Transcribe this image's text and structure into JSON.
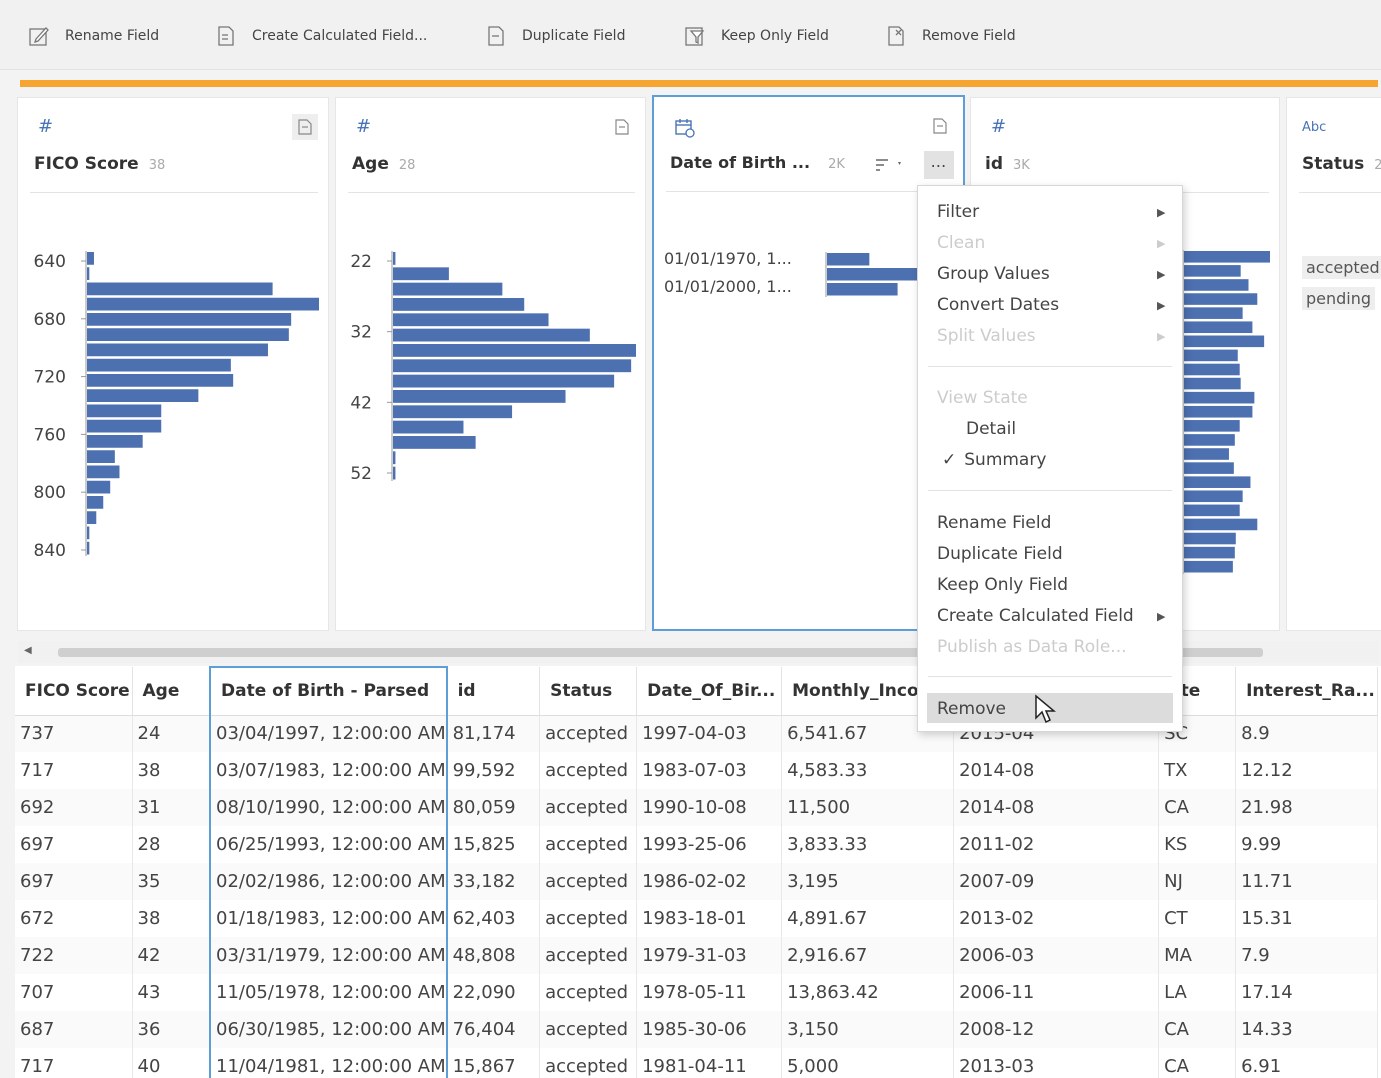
{
  "toolbar": {
    "rename": "Rename Field",
    "calc": "Create Calculated Field...",
    "duplicate": "Duplicate Field",
    "keep_only": "Keep Only Field",
    "remove": "Remove Field"
  },
  "colors": {
    "accent": "#f5a530",
    "bar": "#4d70b0",
    "selection": "#5d9ed6"
  },
  "cards": [
    {
      "title": "FICO Score",
      "count": "38",
      "type_icon": "#",
      "ticks": [
        "640",
        "680",
        "720",
        "760",
        "800",
        "840"
      ]
    },
    {
      "title": "Age",
      "count": "28",
      "type_icon": "#",
      "ticks": [
        "22",
        "32",
        "42",
        "52"
      ]
    },
    {
      "title": "Date of Birth ...",
      "count": "2K",
      "type_icon": "calendar",
      "values": [
        "01/01/1970, 1...",
        "01/01/2000, 1..."
      ]
    },
    {
      "title": "id",
      "count": "3K",
      "type_icon": "#"
    },
    {
      "title": "Status",
      "count": "2",
      "type_icon": "Abc",
      "values": [
        "accepted",
        "pending"
      ]
    }
  ],
  "chart_data": [
    {
      "type": "bar",
      "title": "FICO Score",
      "orientation": "horizontal",
      "y_ticks": [
        640,
        680,
        720,
        760,
        800,
        840
      ],
      "values": [
        3,
        1,
        80,
        100,
        88,
        87,
        78,
        62,
        63,
        48,
        32,
        32,
        24,
        12,
        14,
        10,
        7,
        4,
        1,
        1
      ]
    },
    {
      "type": "bar",
      "title": "Age",
      "orientation": "horizontal",
      "y_ticks": [
        22,
        32,
        42,
        52
      ],
      "values": [
        1,
        23,
        45,
        54,
        64,
        81,
        100,
        98,
        91,
        71,
        49,
        29,
        34,
        1,
        1
      ]
    },
    {
      "type": "bar",
      "title": "Date of Birth",
      "orientation": "horizontal",
      "values": [
        30,
        85,
        50
      ]
    },
    {
      "type": "bar",
      "title": "id",
      "orientation": "horizontal",
      "values": [
        88,
        58,
        66,
        75,
        60,
        70,
        82,
        55,
        57,
        58,
        72,
        70,
        57,
        52,
        46,
        51,
        68,
        60,
        57,
        75,
        53,
        52,
        50
      ]
    }
  ],
  "menu": {
    "filter": "Filter",
    "clean": "Clean",
    "group_values": "Group Values",
    "convert_dates": "Convert Dates",
    "split_values": "Split Values",
    "view_state": "View State",
    "detail": "Detail",
    "summary": "Summary",
    "check": "✓",
    "rename": "Rename Field",
    "duplicate": "Duplicate Field",
    "keep_only": "Keep Only Field",
    "create_calc": "Create Calculated Field",
    "publish": "Publish as Data Role...",
    "remove": "Remove"
  },
  "table": {
    "headers": [
      "FICO Score",
      "Age",
      "Date of Birth - Parsed",
      "id",
      "Status",
      "Date_Of_Bir...",
      "Monthly_Incom",
      "",
      "ate",
      "Interest_Ra..."
    ],
    "rows": [
      [
        "737",
        "24",
        "03/04/1997, 12:00:00 AM",
        "81,174",
        "accepted",
        "1997-04-03",
        "6,541.67",
        "2015-04",
        "SC",
        "8.9"
      ],
      [
        "717",
        "38",
        "03/07/1983, 12:00:00 AM",
        "99,592",
        "accepted",
        "1983-07-03",
        "4,583.33",
        "2014-08",
        "TX",
        "12.12"
      ],
      [
        "692",
        "31",
        "08/10/1990, 12:00:00 AM",
        "80,059",
        "accepted",
        "1990-10-08",
        "11,500",
        "2014-08",
        "CA",
        "21.98"
      ],
      [
        "697",
        "28",
        "06/25/1993, 12:00:00 AM",
        "15,825",
        "accepted",
        "1993-25-06",
        "3,833.33",
        "2011-02",
        "KS",
        "9.99"
      ],
      [
        "697",
        "35",
        "02/02/1986, 12:00:00 AM",
        "33,182",
        "accepted",
        "1986-02-02",
        "3,195",
        "2007-09",
        "NJ",
        "11.71"
      ],
      [
        "672",
        "38",
        "01/18/1983, 12:00:00 AM",
        "62,403",
        "accepted",
        "1983-18-01",
        "4,891.67",
        "2013-02",
        "CT",
        "15.31"
      ],
      [
        "722",
        "42",
        "03/31/1979, 12:00:00 AM",
        "48,808",
        "accepted",
        "1979-31-03",
        "2,916.67",
        "2006-03",
        "MA",
        "7.9"
      ],
      [
        "707",
        "43",
        "11/05/1978, 12:00:00 AM",
        "22,090",
        "accepted",
        "1978-05-11",
        "13,863.42",
        "2006-11",
        "LA",
        "17.14"
      ],
      [
        "687",
        "36",
        "06/30/1985, 12:00:00 AM",
        "76,404",
        "accepted",
        "1985-30-06",
        "3,150",
        "2008-12",
        "CA",
        "14.33"
      ],
      [
        "717",
        "40",
        "11/04/1981, 12:00:00 AM",
        "15,867",
        "accepted",
        "1981-04-11",
        "5,000",
        "2013-03",
        "CA",
        "6.91"
      ]
    ]
  }
}
